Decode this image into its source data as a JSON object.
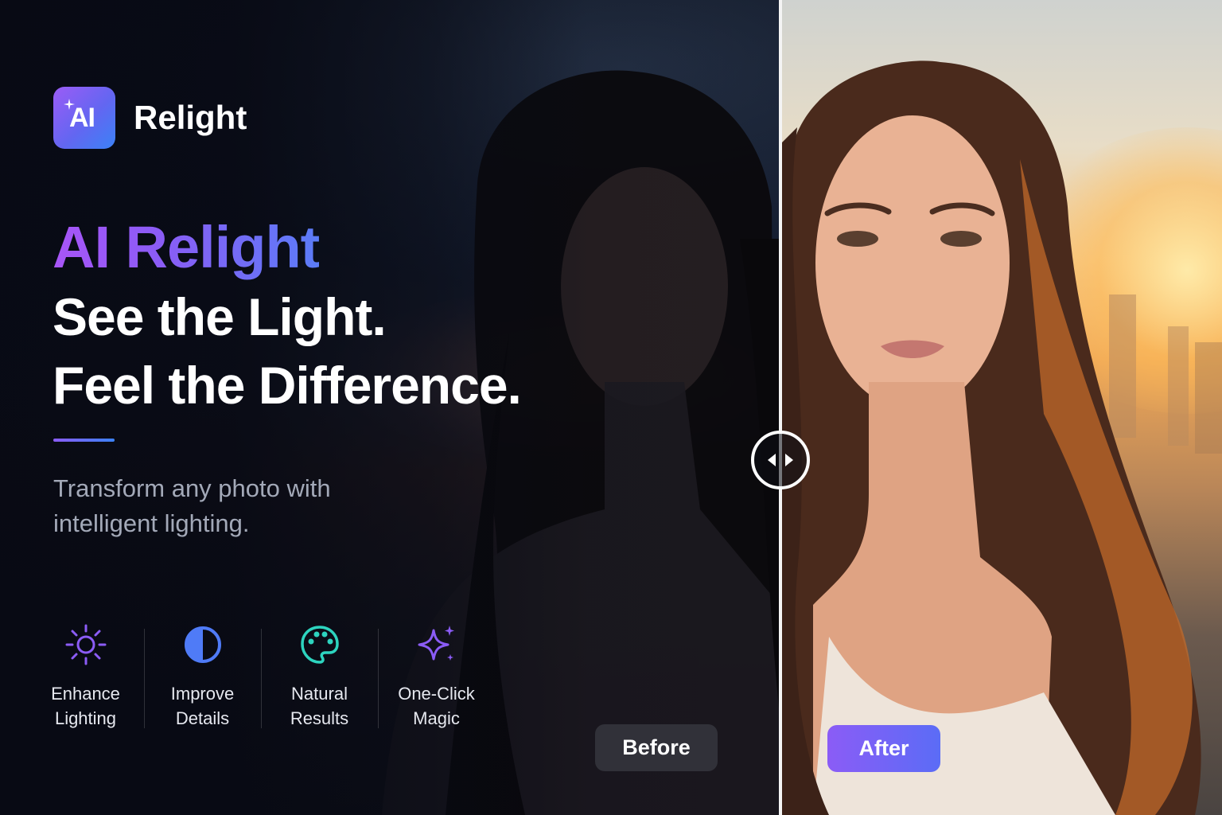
{
  "brand": {
    "logo_text": "AI",
    "name": "Relight"
  },
  "hero": {
    "accent": "AI Relight",
    "line1": "See the Light.",
    "line2": "Feel the Difference.",
    "subtitle": "Transform any photo with intelligent lighting."
  },
  "features": [
    {
      "icon": "sun-icon",
      "line1": "Enhance",
      "line2": "Lighting",
      "color": "#8b5cf6"
    },
    {
      "icon": "contrast-icon",
      "line1": "Improve",
      "line2": "Details",
      "color": "#4f7bf7"
    },
    {
      "icon": "palette-icon",
      "line1": "Natural",
      "line2": "Results",
      "color": "#2dd4bf"
    },
    {
      "icon": "sparkle-icon",
      "line1": "One-Click",
      "line2": "Magic",
      "color": "#8b5cf6"
    }
  ],
  "comparison": {
    "before_label": "Before",
    "after_label": "After",
    "handle_icon": "left-right-arrows-icon"
  },
  "colors": {
    "accent_purple": "#8b5cf6",
    "accent_blue": "#3b82f6",
    "background": "#0a0d17"
  }
}
